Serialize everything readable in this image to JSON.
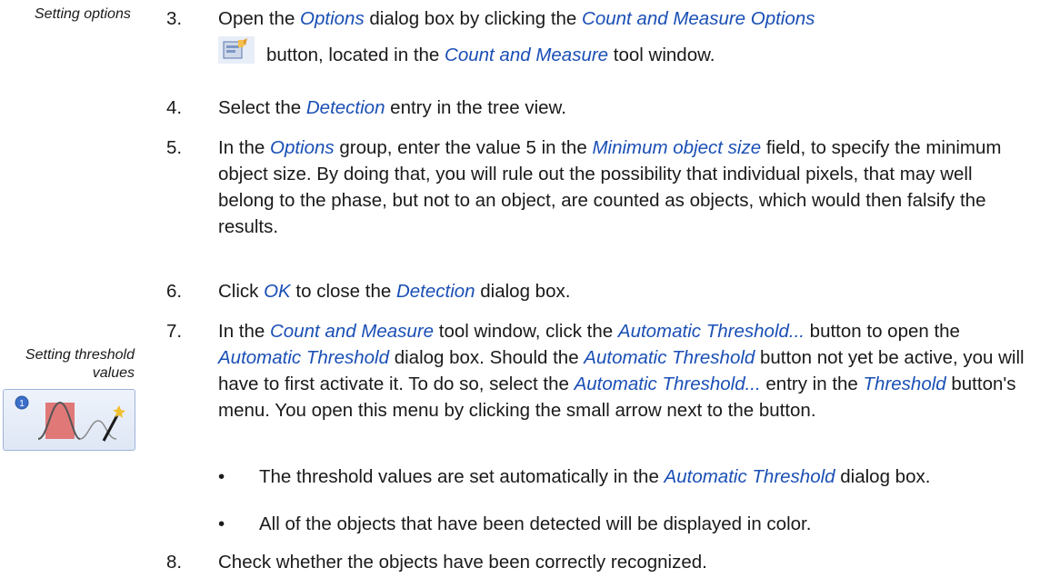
{
  "margin_notes": {
    "setting_options": "Setting options",
    "setting_threshold_line1": "Setting threshold",
    "setting_threshold_line2": "values"
  },
  "steps": [
    {
      "num": "3.",
      "parts": [
        "Open the ",
        "Options",
        " dialog box by clicking the ",
        "Count and Measure Options",
        "button, located in the ",
        "Count and Measure",
        " tool window."
      ]
    },
    {
      "num": "4.",
      "parts": [
        "Select the ",
        "Detection",
        " entry in the tree view."
      ]
    },
    {
      "num": "5.",
      "parts": [
        "In the ",
        "Options",
        " group, enter the value 5 in the ",
        "Minimum object size",
        " field, to specify the minimum object size. By doing that, you will rule out the possibility that individual pixels, that may well belong to the phase, but not to an object, are counted as objects, which would then falsify the results."
      ]
    },
    {
      "num": "6.",
      "parts": [
        "Click ",
        "OK",
        " to close the ",
        "Detection",
        " dialog box."
      ]
    },
    {
      "num": "7.",
      "parts": [
        "In the ",
        "Count and Measure",
        " tool window, click the ",
        "Automatic Threshold...",
        " button to open the ",
        "Automatic Threshold",
        " dialog box. Should the ",
        "Automatic Threshold",
        " button not yet be active, you will have to first activate it. To do so, select the ",
        "Automatic Threshold...",
        " entry in the ",
        "Threshold",
        " button's menu. You open this menu by clicking the small arrow next to the button."
      ]
    },
    {
      "num": "8.",
      "parts": [
        "Check whether the objects have been correctly recognized."
      ]
    }
  ],
  "bullets": [
    {
      "dot": "•",
      "parts": [
        "The threshold values are set automatically in the ",
        "Automatic Threshold",
        " dialog box."
      ]
    },
    {
      "dot": "•",
      "parts": [
        "All of the objects that have been detected will be displayed in color."
      ]
    }
  ],
  "icons": {
    "options_button": "count-and-measure-options-icon",
    "threshold_button": "automatic-threshold-icon"
  },
  "threshold_icon_badge": "1",
  "colors": {
    "highlight": "#1a4fb5",
    "text": "#1a1a1a"
  }
}
